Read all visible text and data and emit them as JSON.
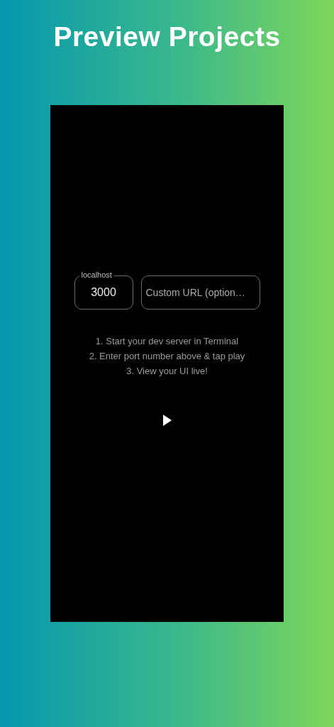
{
  "headline": "Preview Projects",
  "port_field": {
    "label": "localhost",
    "value": "3000"
  },
  "url_field": {
    "placeholder": "Custom URL (option…"
  },
  "instructions": [
    "1. Start your dev server in Terminal",
    "2. Enter port number above & tap play",
    "3. View your UI live!"
  ]
}
